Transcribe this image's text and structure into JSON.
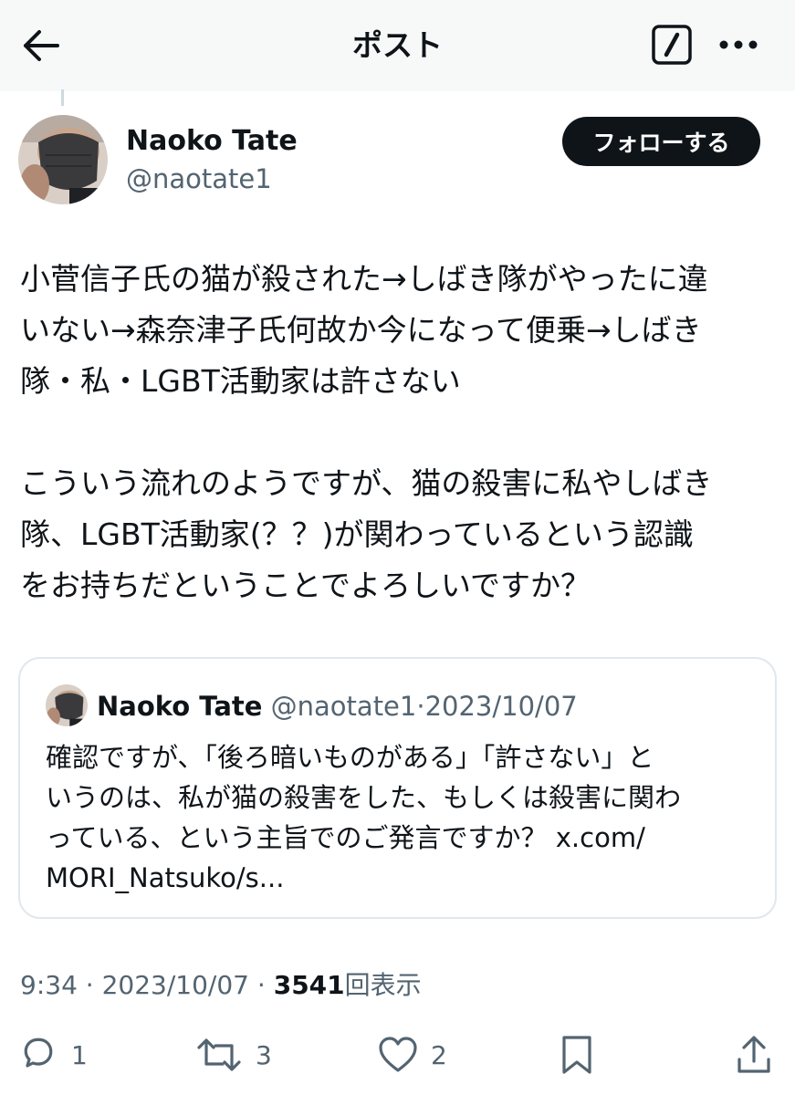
{
  "header": {
    "title": "ポスト",
    "back_icon": "arrow-left-icon",
    "edit_icon": "compose-icon",
    "more_icon": "more-horizontal-icon"
  },
  "author": {
    "name": "Naoko Tate",
    "handle": "@naotate1",
    "follow_label": "フォローする"
  },
  "post": {
    "lines": [
      "小菅信子氏の猫が殺された→しばき隊がやったに違",
      "いない→森奈津子氏何故か今になって便乗→しばき",
      "隊・私・LGBT活動家は許さない",
      "",
      "こういう流れのようですが、猫の殺害に私やしばき",
      "隊、LGBT活動家(？？)が関わっているという認識",
      "をお持ちだということでよろしいですか？"
    ]
  },
  "quote": {
    "name": "Naoko Tate",
    "handle": "@naotate1",
    "separator": "·",
    "date": "2023/10/07",
    "lines": [
      "確認ですが、「後ろ暗いものがある」「許さない」と",
      "いうのは、私が猫の殺害をした、もしくは殺害に関わ",
      "っている、という主旨でのご発言ですか？ x.com/",
      "MORI_Natsuko/s..."
    ]
  },
  "meta": {
    "time": "9:34",
    "separator": "·",
    "date": "2023/10/07",
    "views": "3541",
    "views_label": "回表示"
  },
  "actions": {
    "reply": {
      "icon": "reply-icon",
      "count": "1"
    },
    "retweet": {
      "icon": "retweet-icon",
      "count": "3"
    },
    "like": {
      "icon": "heart-icon",
      "count": "2"
    },
    "bookmark": {
      "icon": "bookmark-icon"
    },
    "share": {
      "icon": "share-icon"
    }
  },
  "colors": {
    "text": "#0f1419",
    "secondary": "#536471",
    "border": "#e1e8ed",
    "button_bg": "#0f1419",
    "header_bg": "#f7f9f9"
  }
}
